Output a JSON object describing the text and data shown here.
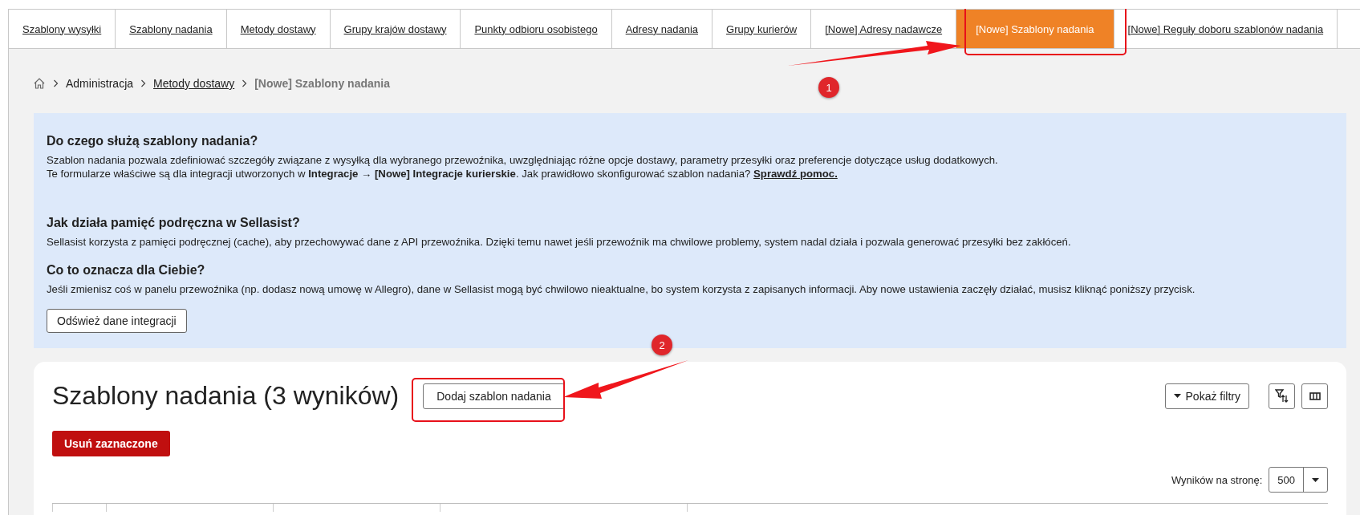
{
  "tabs": [
    {
      "label": "Szablony wysyłki",
      "selected": false
    },
    {
      "label": "Szablony nadania",
      "selected": false
    },
    {
      "label": "Metody dostawy",
      "selected": false
    },
    {
      "label": "Grupy krajów dostawy",
      "selected": false
    },
    {
      "label": "Punkty odbioru osobistego",
      "selected": false
    },
    {
      "label": "Adresy nadania",
      "selected": false
    },
    {
      "label": "Grupy kurierów",
      "selected": false
    },
    {
      "label": "[Nowe] Adresy nadawcze",
      "selected": false
    },
    {
      "label": "[Nowe] Szablony nadania",
      "selected": true
    },
    {
      "label": "[Nowe] Reguły doboru szablonów nadania",
      "selected": false
    }
  ],
  "breadcrumb": [
    {
      "kind": "text",
      "label": "Administracja"
    },
    {
      "kind": "link",
      "label": "Metody dostawy"
    },
    {
      "kind": "current",
      "label": "[Nowe] Szablony nadania"
    }
  ],
  "info": {
    "sections": [
      {
        "heading": "Do czego służą szablony nadania?",
        "lines": [
          {
            "text": "Szablon nadania pozwala zdefiniować szczegóły związane z wysyłką dla wybranego przewoźnika, uwzględniając różne opcje dostawy, parametry przesyłki oraz preferencje dotyczące usług dodatkowych."
          },
          {
            "text": "Te formularze właściwe są dla integracji utworzonych w **Integracje → [Nowe] Integracje kurierskie**. Jak prawidłowo skonfigurować szablon nadania?",
            "link": "Sprawdź pomoc."
          }
        ]
      },
      {
        "heading": "Jak działa pamięć podręczna w Sellasist?",
        "lines": [
          {
            "text": "Sellasist korzysta z pamięci podręcznej (cache), aby przechowywać dane z API przewoźnika. Dzięki temu nawet jeśli przewoźnik ma chwilowe problemy, system nadal działa i pozwala generować przesyłki bez zakłóceń."
          }
        ]
      },
      {
        "heading": "Co to oznacza dla Ciebie?",
        "lines": [
          {
            "text": "Jeśli zmienisz coś w panelu przewoźnika (np. dodasz nową umowę w Allegro), dane w Sellasist mogą być chwilowo nieaktualne, bo system korzysta z zapisanych informacji. Aby nowe ustawienia zaczęły działać, musisz kliknąć poniższy przycisk."
          }
        ]
      }
    ],
    "button": "Odśwież dane integracji"
  },
  "results": {
    "title": "Szablony nadania (3 wyników)",
    "add_button": "Dodaj szablon nadania",
    "filters_button": "Pokaż filtry",
    "delete_button": "Usuń zaznaczone",
    "per_page_label": "Wyników na stronę:",
    "per_page_value": "500"
  },
  "annotations": [
    {
      "number": "1"
    },
    {
      "number": "2"
    }
  ]
}
